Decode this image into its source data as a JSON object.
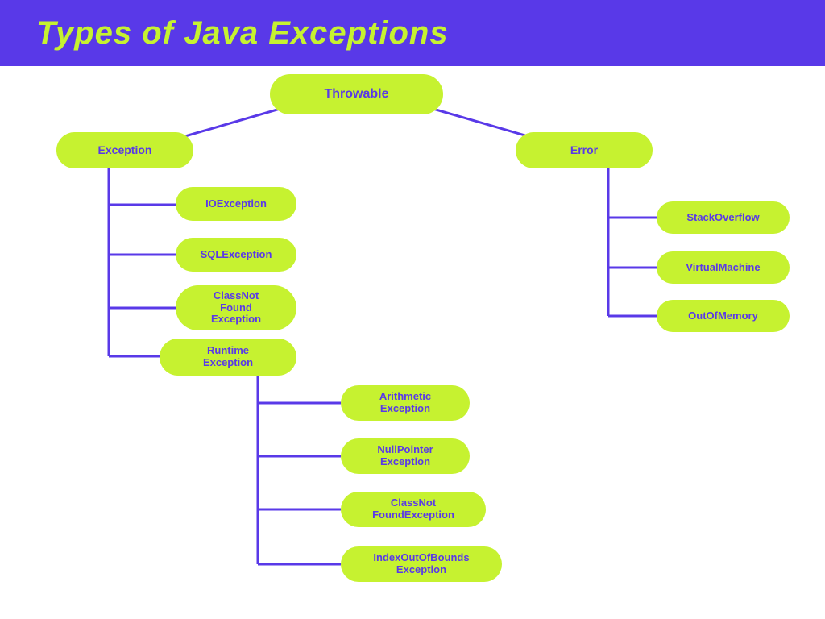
{
  "header": {
    "title": "Types of Java Exceptions"
  },
  "colors": {
    "accent": "#5939e8",
    "node": "#c6f230",
    "bg": "#ffffff"
  },
  "nodes": {
    "throwable": "Throwable",
    "exception": "Exception",
    "error": "Error",
    "ioexception": "IOException",
    "sqlexception": "SQLException",
    "classnotfound": "ClassNot\nFound\nException",
    "runtime": "Runtime\nException",
    "arithmetic": "Arithmetic\nException",
    "nullpointer": "NullPointer\nException",
    "classnotfound2": "ClassNot\nFoundException",
    "indexoutofbounds": "IndexOutOfBounds\nException",
    "stackoverflow": "StackOverflow",
    "virtualmachine": "VirtualMachine",
    "outofmemory": "OutOfMemory"
  }
}
